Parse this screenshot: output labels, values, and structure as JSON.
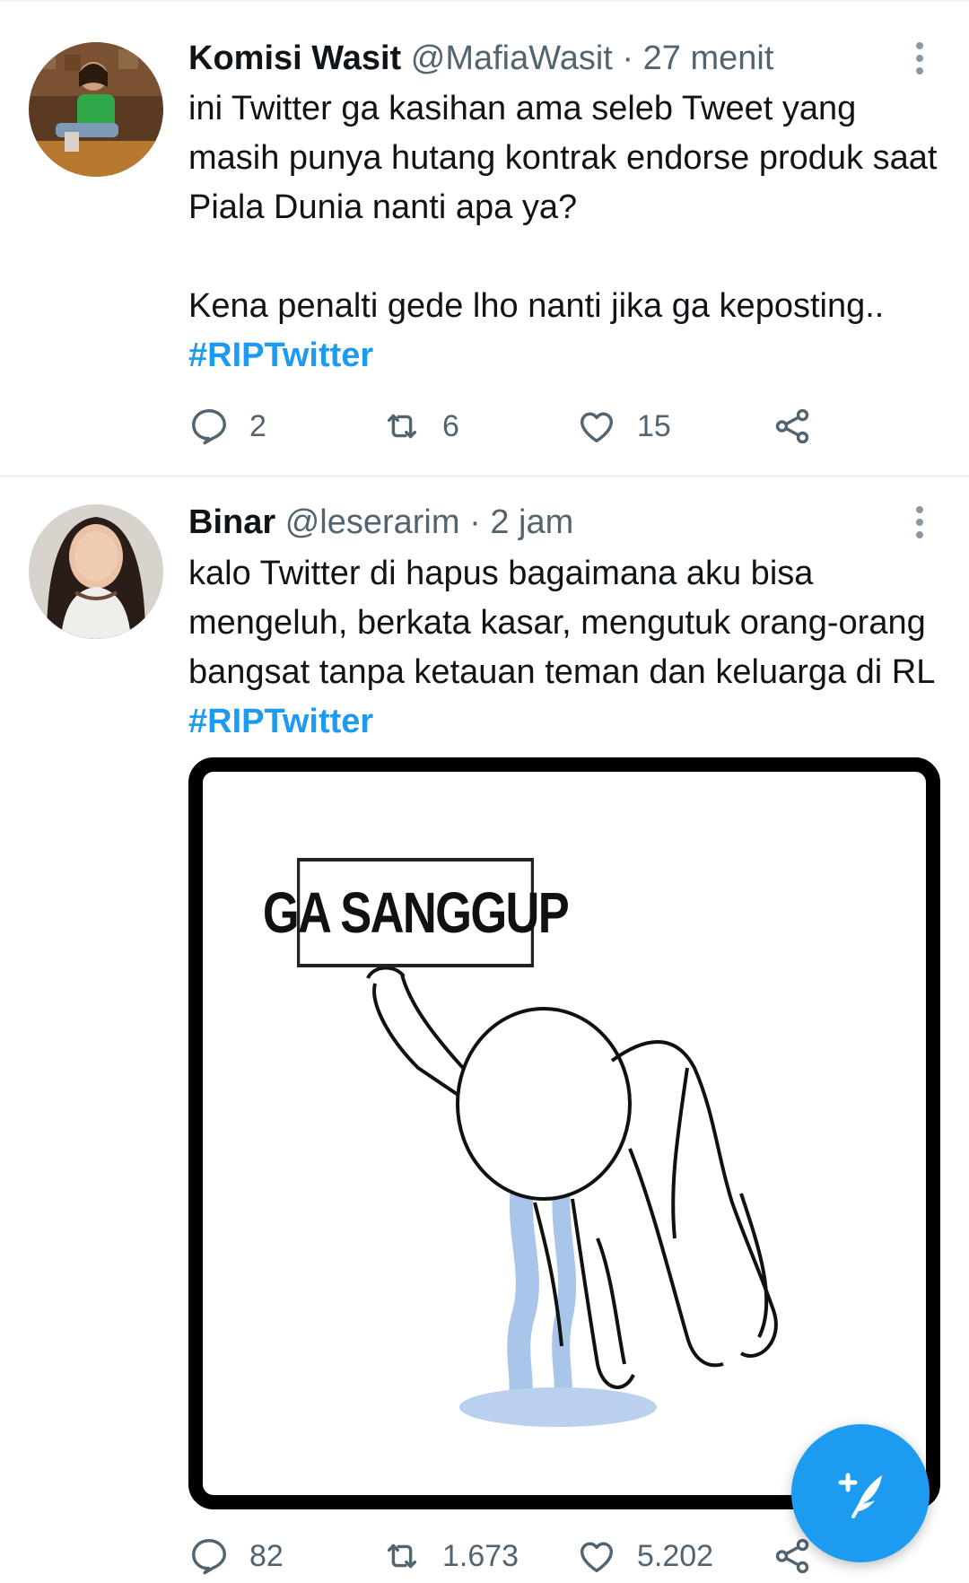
{
  "colors": {
    "accent": "#1d9bf0",
    "text": "#0f1419",
    "secondary": "#536471",
    "divider": "#eff3f4"
  },
  "tweets": [
    {
      "name": "Komisi Wasit",
      "handle": "@MafiaWasit",
      "separator": "·",
      "time": "27 menit",
      "text_line1": "ini Twitter ga kasihan ama seleb Tweet yang masih punya hutang kontrak endorse produk saat Piala Dunia nanti apa ya?",
      "text_line2": "Kena penalti gede lho nanti jika ga keposting..",
      "hashtag": "#RIPTwitter",
      "replies": "2",
      "retweets": "6",
      "likes": "15",
      "icons": [
        "more-vertical-icon",
        "reply-icon",
        "retweet-icon",
        "like-icon",
        "share-icon"
      ]
    },
    {
      "name": "Binar",
      "handle": "@leserarim",
      "separator": "·",
      "time": "2 jam",
      "text": "kalo Twitter di hapus bagaimana aku bisa mengeluh, berkata kasar, mengutuk orang-orang bangsat tanpa ketauan teman dan keluarga di RL",
      "hashtag": "#RIPTwitter",
      "media_text": "GA SANGGUP",
      "replies": "82",
      "retweets": "1.673",
      "likes": "5.202",
      "icons": [
        "more-vertical-icon",
        "reply-icon",
        "retweet-icon",
        "like-icon",
        "share-icon"
      ]
    }
  ],
  "fab": {
    "icon": "compose-tweet-icon"
  }
}
